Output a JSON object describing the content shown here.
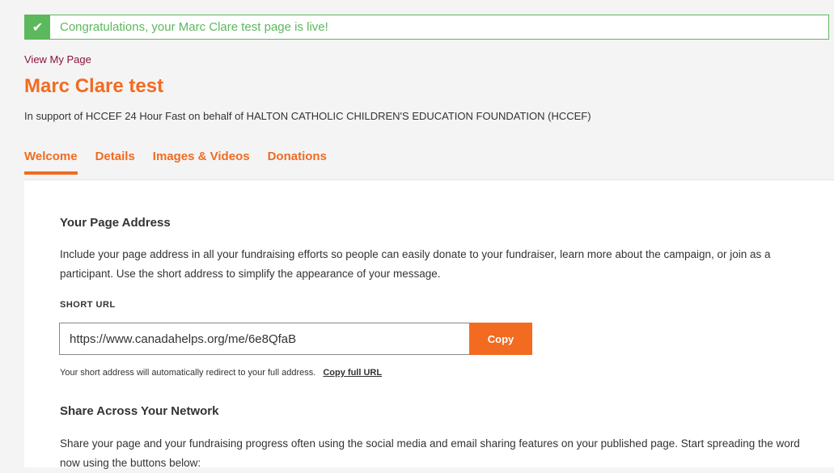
{
  "banner": {
    "icon": "check-icon",
    "message": "Congratulations, your Marc Clare test page is live!",
    "color": "#5cb85c"
  },
  "header": {
    "view_link": "View My Page",
    "title": "Marc Clare test",
    "support_text": "In support of HCCEF 24 Hour Fast on behalf of HALTON CATHOLIC CHILDREN'S EDUCATION FOUNDATION (HCCEF)"
  },
  "tabs": [
    {
      "label": "Welcome",
      "active": true
    },
    {
      "label": "Details",
      "active": false
    },
    {
      "label": "Images & Videos",
      "active": false
    },
    {
      "label": "Donations",
      "active": false
    }
  ],
  "page_address": {
    "heading": "Your Page Address",
    "description": "Include your page address in all your fundraising efforts so people can easily donate to your fundraiser, learn more about the campaign, or join as a participant. Use the short address to simplify the appearance of your message.",
    "short_url_label": "SHORT URL",
    "short_url_value": "https://www.canadahelps.org/me/6e8QfaB",
    "copy_label": "Copy",
    "redirect_text": "Your short address will automatically redirect to your full address.",
    "copy_full_label": "Copy full URL"
  },
  "share": {
    "heading": "Share Across Your Network",
    "description": "Share your page and your fundraising progress often using the social media and email sharing features on your published page. Start spreading the word now using the buttons below:"
  },
  "colors": {
    "accent": "#f26b21",
    "link": "#8a1538",
    "success": "#5cb85c"
  }
}
